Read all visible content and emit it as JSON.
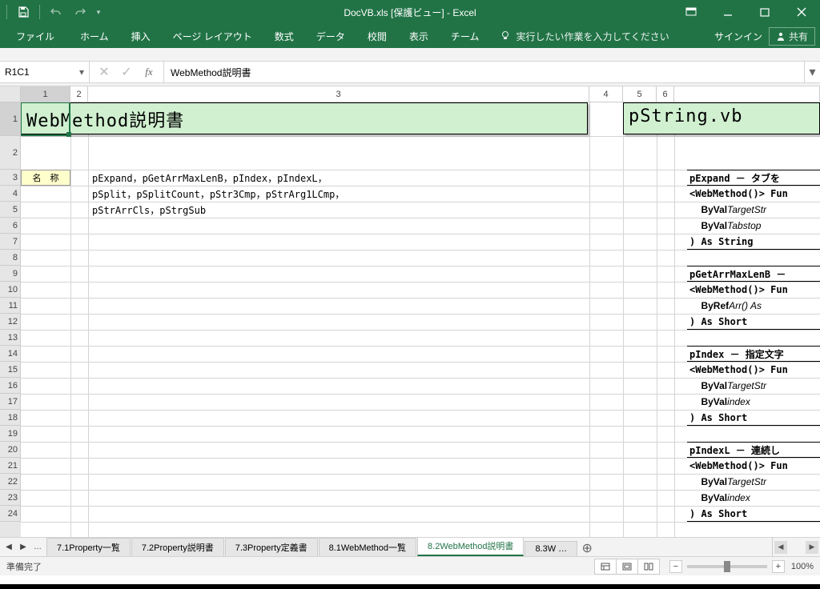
{
  "app": {
    "title": "DocVB.xls  [保護ビュー] - Excel",
    "signin": "サインイン",
    "share": "共有"
  },
  "ribbon": {
    "file": "ファイル",
    "home": "ホーム",
    "insert": "挿入",
    "pagelayout": "ページ レイアウト",
    "formulas": "数式",
    "data": "データ",
    "review": "校閲",
    "view": "表示",
    "team": "チーム",
    "tellme": "実行したい作業を入力してください"
  },
  "namebox": "R1C1",
  "formula": "WebMethod説明書",
  "columns": [
    "1",
    "2",
    "3",
    "4",
    "5",
    "6"
  ],
  "rows": [
    "1",
    "2",
    "3",
    "4",
    "5",
    "6",
    "7",
    "8",
    "9",
    "10",
    "11",
    "12",
    "13",
    "14",
    "15",
    "16",
    "17",
    "18",
    "19",
    "20",
    "21",
    "22",
    "23",
    "24"
  ],
  "sheet": {
    "title1": "WebMethod説明書",
    "title2": "pString.vb",
    "label_name": "名　称",
    "line3": "pExpand，pGetArrMaxLenB，pIndex，pIndexL，",
    "line4": "pSplit，pSplitCount，pStr3Cmp，pStrArg1LCmp，",
    "line5": "pStrArrCls，pStrgSub",
    "r3b": "pExpand － タブを",
    "r4b": "<WebMethod()> Fun",
    "r5b_1": "ByVal ",
    "r5b_2": "TargetStr",
    "r6b_1": "ByVal ",
    "r6b_2": "Tabstop",
    "r7b": ") As String",
    "r9b": "pGetArrMaxLenB －",
    "r10b": "<WebMethod()> Fun",
    "r11b_1": "ByRef ",
    "r11b_2": "Arr()  As",
    "r12b": ") As Short",
    "r14b": "pIndex － 指定文字",
    "r15b": "<WebMethod()> Fun",
    "r16b_1": "ByVal ",
    "r16b_2": "TargetStr",
    "r17b_1": "ByVal ",
    "r17b_2": "index",
    "r18b": ") As Short",
    "r20b": "pIndexL － 連続し",
    "r21b": "<WebMethod()> Fun",
    "r22b_1": "ByVal ",
    "r22b_2": "TargetStr",
    "r23b_1": "ByVal ",
    "r23b_2": "index",
    "r24b": ") As Short"
  },
  "tabs": {
    "t1": "7.1Property一覧",
    "t2": "7.2Property説明書",
    "t3": "7.3Property定義書",
    "t4": "8.1WebMethod一覧",
    "t5": "8.2WebMethod説明書",
    "t6": "8.3W"
  },
  "status": {
    "ready": "準備完了",
    "zoom": "100%"
  }
}
